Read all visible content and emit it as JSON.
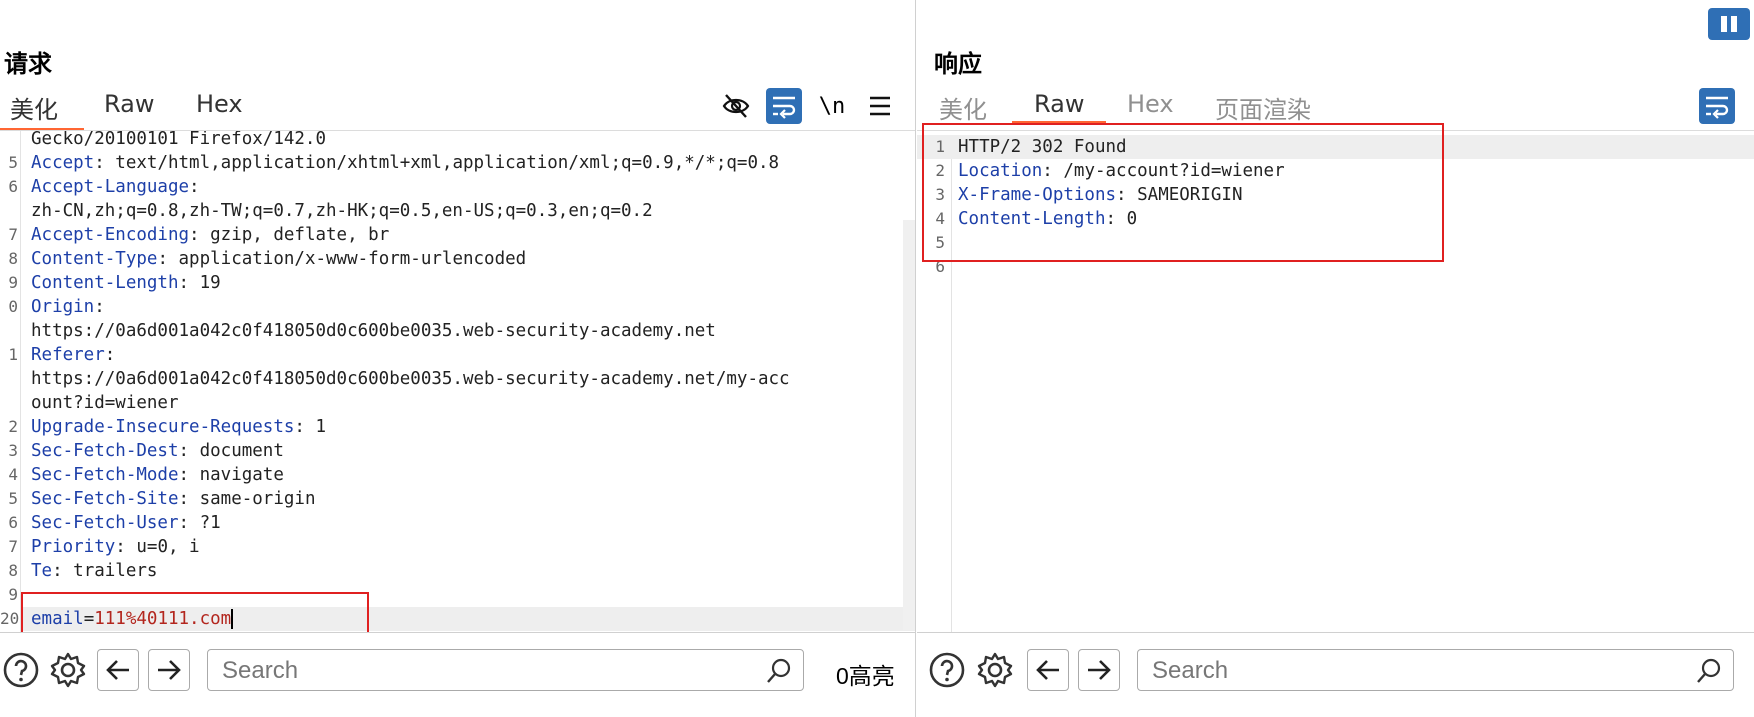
{
  "request": {
    "title": "请求",
    "tabs": [
      {
        "label": "美化",
        "active": true
      },
      {
        "label": "Raw",
        "active": false
      },
      {
        "label": "Hex",
        "active": false
      }
    ],
    "toolbar_icons": [
      "eye-slash-icon",
      "wrap-icon",
      "newline-icon",
      "menu-icon"
    ],
    "newline_label": "\\n",
    "lines": [
      {
        "num": "",
        "key": "",
        "sep": "",
        "value": "Gecko/20100101 Firefox/142.0"
      },
      {
        "num": "5",
        "key": "Accept",
        "sep": ": ",
        "value": "text/html,application/xhtml+xml,application/xml;q=0.9,*/*;q=0.8"
      },
      {
        "num": "6",
        "key": "Accept-Language",
        "sep": ":",
        "value": ""
      },
      {
        "num": "",
        "key": "",
        "sep": "",
        "value": "zh-CN,zh;q=0.8,zh-TW;q=0.7,zh-HK;q=0.5,en-US;q=0.3,en;q=0.2"
      },
      {
        "num": "7",
        "key": "Accept-Encoding",
        "sep": ": ",
        "value": "gzip, deflate, br"
      },
      {
        "num": "8",
        "key": "Content-Type",
        "sep": ": ",
        "value": "application/x-www-form-urlencoded"
      },
      {
        "num": "9",
        "key": "Content-Length",
        "sep": ": ",
        "value": "19"
      },
      {
        "num": "0",
        "key": "Origin",
        "sep": ":",
        "value": ""
      },
      {
        "num": "",
        "key": "",
        "sep": "",
        "value": "https://0a6d001a042c0f418050d0c600be0035.web-security-academy.net"
      },
      {
        "num": "1",
        "key": "Referer",
        "sep": ":",
        "value": ""
      },
      {
        "num": "",
        "key": "",
        "sep": "",
        "value": "https://0a6d001a042c0f418050d0c600be0035.web-security-academy.net/my-acc"
      },
      {
        "num": "",
        "key": "",
        "sep": "",
        "value": "ount?id=wiener"
      },
      {
        "num": "2",
        "key": "Upgrade-Insecure-Requests",
        "sep": ": ",
        "value": "1"
      },
      {
        "num": "3",
        "key": "Sec-Fetch-Dest",
        "sep": ": ",
        "value": "document"
      },
      {
        "num": "4",
        "key": "Sec-Fetch-Mode",
        "sep": ": ",
        "value": "navigate"
      },
      {
        "num": "5",
        "key": "Sec-Fetch-Site",
        "sep": ": ",
        "value": "same-origin"
      },
      {
        "num": "6",
        "key": "Sec-Fetch-User",
        "sep": ": ",
        "value": "?1"
      },
      {
        "num": "7",
        "key": "Priority",
        "sep": ": ",
        "value": "u=0, i"
      },
      {
        "num": "8",
        "key": "Te",
        "sep": ": ",
        "value": "trailers"
      },
      {
        "num": "9",
        "key": "",
        "sep": "",
        "value": ""
      }
    ],
    "body_line": {
      "num": "20",
      "key": "email",
      "eq": "=",
      "value": "111%40111.com"
    },
    "search_placeholder": "Search",
    "highlight_count": "0高亮"
  },
  "response": {
    "title": "响应",
    "tabs": [
      {
        "label": "美化",
        "active": false
      },
      {
        "label": "Raw",
        "active": true
      },
      {
        "label": "Hex",
        "active": false
      },
      {
        "label": "页面渲染",
        "active": false
      }
    ],
    "lines": [
      {
        "num": "1",
        "key": "",
        "sep": "",
        "value": "HTTP/2 302 Found"
      },
      {
        "num": "2",
        "key": "Location",
        "sep": ": ",
        "value": "/my-account?id=wiener"
      },
      {
        "num": "3",
        "key": "X-Frame-Options",
        "sep": ": ",
        "value": "SAMEORIGIN"
      },
      {
        "num": "4",
        "key": "Content-Length",
        "sep": ": ",
        "value": "0"
      },
      {
        "num": "5",
        "key": "",
        "sep": "",
        "value": ""
      },
      {
        "num": "6",
        "key": "",
        "sep": "",
        "value": ""
      }
    ],
    "search_placeholder": "Search"
  },
  "colors": {
    "accent": "#2f6fb5",
    "tab_underline": "#ff6633",
    "header_key": "#1d3fa8",
    "highlight_box": "#e02020"
  }
}
